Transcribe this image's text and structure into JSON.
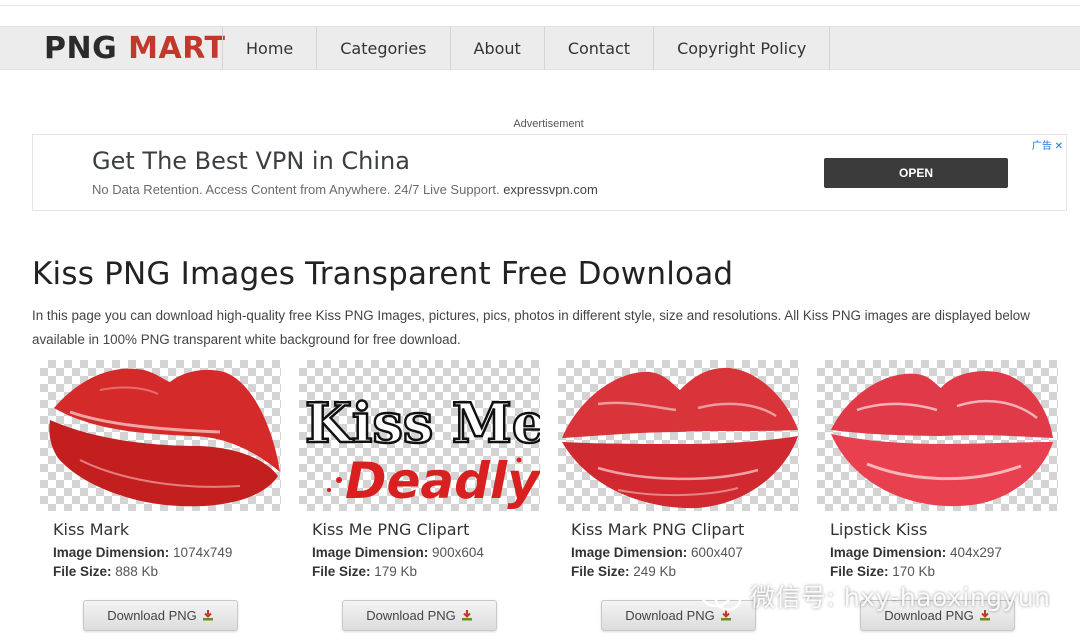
{
  "header": {
    "logo_png": "PNG",
    "logo_mart": "MART",
    "nav": [
      "Home",
      "Categories",
      "About",
      "Contact",
      "Copyright Policy"
    ]
  },
  "ad": {
    "label": "Advertisement",
    "headline": "Get The Best VPN in China",
    "description": "No Data Retention. Access Content from Anywhere. 24/7 Live Support.",
    "domain": "expressvpn.com",
    "button": "OPEN",
    "corner": "广告 ✕"
  },
  "main": {
    "title": "Kiss PNG Images Transparent Free Download",
    "intro": "In this page you can download high-quality free Kiss PNG Images, pictures, pics, photos in different style, size and resolutions. All Kiss PNG images are displayed below available in 100% PNG transparent white background for free download."
  },
  "labels": {
    "dimension": "Image Dimension:",
    "filesize": "File Size:",
    "download": "Download PNG"
  },
  "items": [
    {
      "title": "Kiss Mark",
      "dimension": "1074x749",
      "size": "888 Kb"
    },
    {
      "title": "Kiss Me PNG Clipart",
      "dimension": "900x604",
      "size": "179 Kb",
      "image_text": [
        "Kiss Me",
        "Deadly"
      ]
    },
    {
      "title": "Kiss Mark PNG Clipart",
      "dimension": "600x407",
      "size": "249 Kb"
    },
    {
      "title": "Lipstick Kiss",
      "dimension": "404x297",
      "size": "170 Kb"
    }
  ],
  "watermark": "微信号: hxy-haoxingyun",
  "colors": {
    "brand_red": "#c0392b",
    "lips_red": "#d42a2a",
    "nav_bg": "#ececec",
    "ad_button": "#3b3b3b"
  }
}
